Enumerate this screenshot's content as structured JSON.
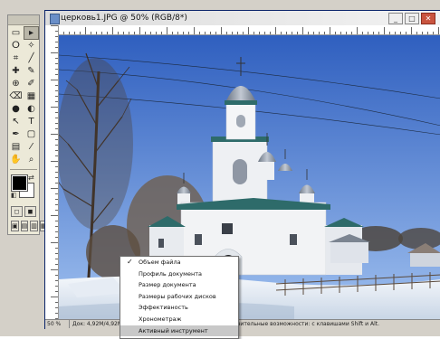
{
  "document": {
    "title": "церковь1.JPG @ 50% (RGB/8*)",
    "window_buttons": [
      "_",
      "□",
      "✕"
    ]
  },
  "status": {
    "zoom": "50 %",
    "doc_size": "Док: 4,92М/4,92М",
    "arrow": "▶",
    "hint": "олнительные возможности: с клавишами Shift и Alt."
  },
  "toolbox": {
    "tools": [
      {
        "glyph": "▭",
        "name": "marquee-tool-icon",
        "active": false
      },
      {
        "glyph": "▸",
        "name": "move-tool-icon",
        "active": true
      },
      {
        "glyph": "ⵔ",
        "name": "lasso-tool-icon",
        "active": false
      },
      {
        "glyph": "✧",
        "name": "magic-wand-icon",
        "active": false
      },
      {
        "glyph": "⌗",
        "name": "crop-tool-icon",
        "active": false
      },
      {
        "glyph": "╱",
        "name": "slice-tool-icon",
        "active": false
      },
      {
        "glyph": "✚",
        "name": "healing-brush-icon",
        "active": false
      },
      {
        "glyph": "✎",
        "name": "brush-tool-icon",
        "active": false
      },
      {
        "glyph": "⊕",
        "name": "clone-stamp-icon",
        "active": false
      },
      {
        "glyph": "✐",
        "name": "history-brush-icon",
        "active": false
      },
      {
        "glyph": "⌫",
        "name": "eraser-tool-icon",
        "active": false
      },
      {
        "glyph": "▦",
        "name": "gradient-tool-icon",
        "active": false
      },
      {
        "glyph": "●",
        "name": "blur-tool-icon",
        "active": false
      },
      {
        "glyph": "◐",
        "name": "dodge-tool-icon",
        "active": false
      },
      {
        "glyph": "↖",
        "name": "path-selection-icon",
        "active": false
      },
      {
        "glyph": "T",
        "name": "type-tool-icon",
        "active": false
      },
      {
        "glyph": "✒",
        "name": "pen-tool-icon",
        "active": false
      },
      {
        "glyph": "▢",
        "name": "shape-tool-icon",
        "active": false
      },
      {
        "glyph": "▤",
        "name": "notes-tool-icon",
        "active": false
      },
      {
        "glyph": "⁄",
        "name": "eyedropper-icon",
        "active": false
      },
      {
        "glyph": "✋",
        "name": "hand-tool-icon",
        "active": false
      },
      {
        "glyph": "⌕",
        "name": "zoom-tool-icon",
        "active": false
      }
    ],
    "modes": [
      "◻",
      "◼",
      "▣",
      "▤",
      "▥",
      "▦"
    ]
  },
  "menu": {
    "items": [
      {
        "label": "Объем файла",
        "checked": true,
        "highlight": false
      },
      {
        "label": "Профиль документа",
        "checked": false,
        "highlight": false
      },
      {
        "label": "Размер документа",
        "checked": false,
        "highlight": false
      },
      {
        "label": "Размеры рабочих дисков",
        "checked": false,
        "highlight": false
      },
      {
        "label": "Эффективность",
        "checked": false,
        "highlight": false
      },
      {
        "label": "Хронометраж",
        "checked": false,
        "highlight": false
      },
      {
        "label": "Активный инструмент",
        "checked": false,
        "highlight": true
      }
    ]
  },
  "colors": {
    "sky_top": "#2f5fbf",
    "sky_bottom": "#9fc0ef",
    "church_white": "#f2f3f5",
    "roof_teal": "#2e6b6a",
    "dome_gray": "#8d97a6",
    "snow": "#e9eef6",
    "tree_dark": "#4a3a2e"
  }
}
